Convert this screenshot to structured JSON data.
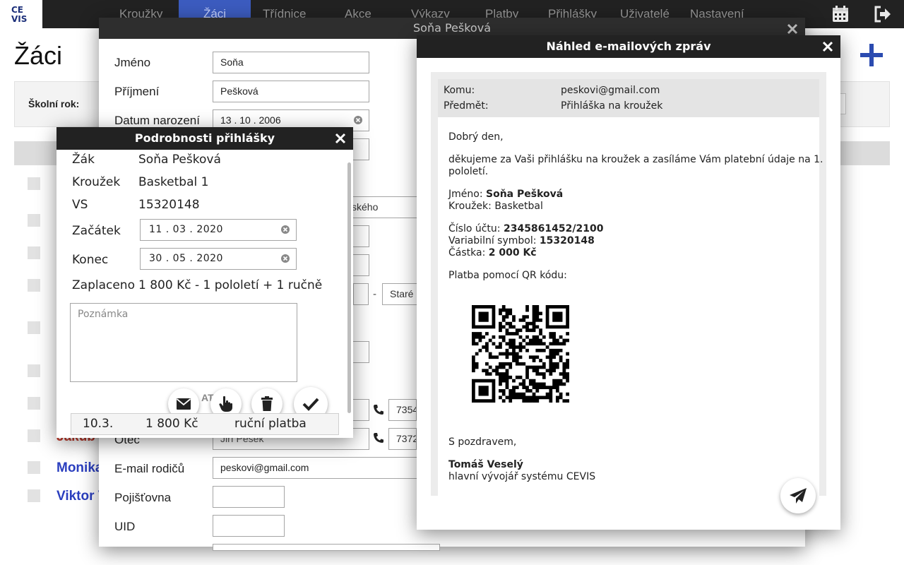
{
  "app": {
    "logo_line1": "CE",
    "logo_line2": "VIS"
  },
  "nav": {
    "items": [
      {
        "label": "Kroužky"
      },
      {
        "label": "Žáci"
      },
      {
        "label": "Třídnice"
      },
      {
        "label": "Akce"
      },
      {
        "label": "Výkazy"
      },
      {
        "label": "Platby"
      },
      {
        "label": "Přihlášky"
      },
      {
        "label": "Uživatelé"
      },
      {
        "label": "Nastavení"
      }
    ],
    "active_index": 1
  },
  "page": {
    "title": "Žáci",
    "school_year_label": "Školní rok:",
    "visible_students": [
      {
        "name": "Jakub Š"
      },
      {
        "name": "Monika"
      },
      {
        "name": "Viktor V"
      }
    ]
  },
  "student_dialog": {
    "title": "Soňa Pešková",
    "fields": {
      "first_name": {
        "label": "Jméno",
        "value": "Soňa"
      },
      "last_name": {
        "label": "Příjmení",
        "value": "Pešková"
      },
      "birth_date": {
        "label": "Datum narození",
        "value": "13 . 10 . 2006"
      },
      "father": {
        "label": "Otec",
        "value": "Jiří Pešek"
      },
      "parent_email": {
        "label": "E-mail rodičů",
        "value": "peskovi@gmail.com"
      },
      "insurance": {
        "label": "Pojišťovna",
        "value": ""
      },
      "uid": {
        "label": "UID",
        "value": ""
      }
    },
    "partial_texts": {
      "address_fragment": "vského",
      "select_fragment": "Staré",
      "phone1_fragment": "7354",
      "phone2_fragment": "7372"
    }
  },
  "application_dialog": {
    "title": "Podrobnosti přihlášky",
    "student": {
      "label": "Žák",
      "value": "Soňa Pešková"
    },
    "club": {
      "label": "Kroužek",
      "value": "Basketbal 1"
    },
    "vs": {
      "label": "VS",
      "value": "15320148"
    },
    "start": {
      "label": "Začátek",
      "value": "11 . 03 . 2020"
    },
    "end": {
      "label": "Konec",
      "value": "30 . 05 . 2020"
    },
    "paid": {
      "label": "Zaplaceno",
      "value": "1 800 Kč - 1 pololetí + 1 ručně"
    },
    "note_placeholder": "Poznámka",
    "obscured_fragment": "ATE",
    "payment": {
      "date": "10.3.",
      "amount": "1 800 Kč",
      "method": "ruční platba"
    }
  },
  "email_dialog": {
    "title": "Náhled e-mailových zpráv",
    "to_label": "Komu:",
    "to_value": "peskovi@gmail.com",
    "subject_label": "Předmět:",
    "subject_value": "Přihláška na kroužek",
    "greeting": "Dobrý den,",
    "intro_line1": "děkujeme za Vaši přihlášku na kroužek a zasíláme Vám platební údaje na 1.",
    "intro_line2": "pololetí.",
    "name_label": "Jméno:",
    "name_value": "Soňa Pešková",
    "club_label": "Kroužek:",
    "club_value": "Basketbal",
    "account_label": "Číslo účtu:",
    "account_value": "2345861452/2100",
    "vs_label": "Variabilní symbol:",
    "vs_value": "15320148",
    "amount_label": "Částka:",
    "amount_value": "2 000 Kč",
    "qr_label": "Platba pomocí QR kódu:",
    "closing": "S pozdravem,",
    "signature_name": "Tomáš Veselý",
    "signature_role": "hlavní vývojář systému CEVIS"
  },
  "colors": {
    "nav_bg": "#222222",
    "nav_active": "#3c5cc0",
    "dialog_header": "#222222",
    "link_blue": "#2b3fbf"
  }
}
